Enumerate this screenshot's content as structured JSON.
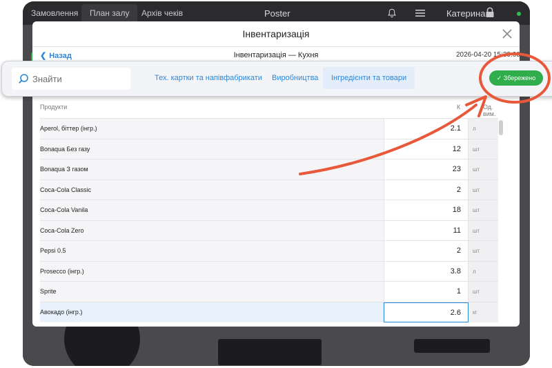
{
  "topbar": {
    "tabs": [
      "Замовлення",
      "План залу",
      "Архів чеків"
    ],
    "active_tab_index": 1,
    "brand": "Poster",
    "user": "Катерина",
    "icons": [
      "bell-icon",
      "menu-icon",
      "lock-icon"
    ],
    "status_color": "#2fbd4e"
  },
  "modal": {
    "title": "Інвентаризація",
    "back_label": "Назад",
    "subtitle": "Інвентаризація — Кухня",
    "date": "2026-04-20 15:39:00"
  },
  "toolbar": {
    "search_placeholder": "Знайти",
    "tabs": [
      "Тех. картки та напівфабрикати",
      "Виробництва",
      "Інгредієнти та товари"
    ],
    "active_tab_index": 2,
    "save_label": "✓ Збережено",
    "accent_color": "#2d86d9",
    "save_color": "#2fae4b"
  },
  "table": {
    "headers": {
      "products": "Продукти",
      "qty": "К",
      "unit": "Од. вим."
    },
    "rows": [
      {
        "name": "Aperol, біттер (інгр.)",
        "qty": "2.1",
        "unit": "л"
      },
      {
        "name": "Bonaqua Без газу",
        "qty": "12",
        "unit": "шт"
      },
      {
        "name": "Bonaqua З газом",
        "qty": "23",
        "unit": "шт"
      },
      {
        "name": "Coca-Cola Classic",
        "qty": "2",
        "unit": "шт"
      },
      {
        "name": "Coca-Cola Vanila",
        "qty": "18",
        "unit": "шт"
      },
      {
        "name": "Coca-Cola Zero",
        "qty": "11",
        "unit": "шт"
      },
      {
        "name": "Pepsi 0.5",
        "qty": "2",
        "unit": "шт"
      },
      {
        "name": "Prosecco (інгр.)",
        "qty": "3.8",
        "unit": "л"
      },
      {
        "name": "Sprite",
        "qty": "1",
        "unit": "шт"
      },
      {
        "name": "Авокадо (інгр.)",
        "qty": "2.6",
        "unit": "кг"
      }
    ],
    "selected_row_index": 9
  },
  "annotation": {
    "color": "#e8583a"
  }
}
